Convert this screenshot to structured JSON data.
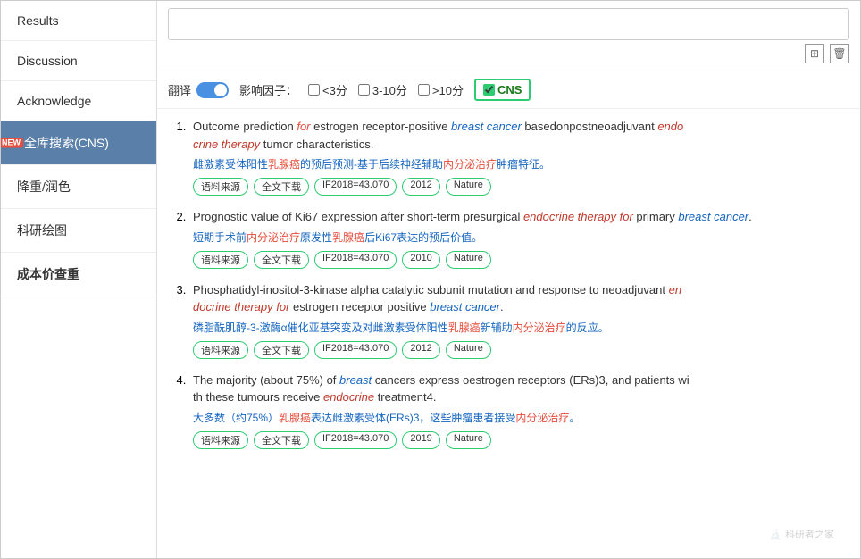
{
  "sidebar": {
    "items": [
      {
        "label": "Results",
        "active": false,
        "id": "results"
      },
      {
        "label": "Discussion",
        "active": false,
        "id": "discussion"
      },
      {
        "label": "Acknowledge",
        "active": false,
        "id": "acknowledge"
      },
      {
        "label": "全库搜索(CNS)",
        "active": true,
        "id": "cns-search",
        "hasNew": true
      },
      {
        "label": "降重/润色",
        "active": false,
        "id": "reduce"
      },
      {
        "label": "科研绘图",
        "active": false,
        "id": "drawing"
      },
      {
        "label": "成本价查重",
        "active": false,
        "id": "cost-check"
      }
    ]
  },
  "filter": {
    "translate_label": "翻译",
    "impact_label": "影响因子：",
    "options": [
      {
        "label": "<3分",
        "checked": false
      },
      {
        "label": "3-10分",
        "checked": false
      },
      {
        "label": ">10分",
        "checked": false
      }
    ],
    "cns_label": "CNS",
    "cns_checked": true
  },
  "results": [
    {
      "index": 1,
      "title_parts": [
        {
          "text": "Outcome prediction ",
          "style": "normal"
        },
        {
          "text": "for",
          "style": "italic-red"
        },
        {
          "text": " estrogen receptor-positive ",
          "style": "normal"
        },
        {
          "text": "breast cancer",
          "style": "italic-blue"
        },
        {
          "text": " basedonpostneoadjuvant ",
          "style": "normal"
        },
        {
          "text": "endo",
          "style": "italic-red"
        },
        {
          "text": "crine therapy",
          "style": "italic-red"
        },
        {
          "text": " tumor characteristics.",
          "style": "normal"
        }
      ],
      "title": "Outcome prediction for estrogen receptor-positive breast cancer basedonpostneoadjuvant endocrine therapy tumor characteristics.",
      "chinese": "雌激素受体阳性乳腺癌的预后预测-基于后续神经辅助内分泌治疗肿瘤特征。",
      "tags": [
        "语料来源",
        "全文下载",
        "IF2018=43.070",
        "2012",
        "Nature"
      ]
    },
    {
      "index": 2,
      "title": "Prognostic value of Ki67 expression after short-term presurgical endocrine therapy for primary breast cancer.",
      "chinese": "短期手术前内分泌治疗原发性乳腺癌后Ki67表达的预后价值。",
      "tags": [
        "语料来源",
        "全文下载",
        "IF2018=43.070",
        "2010",
        "Nature"
      ]
    },
    {
      "index": 3,
      "title": "Phosphatidyl-inositol-3-kinase alpha catalytic subunit mutation and response to neoadjuvant endocrine therapy for estrogen receptor positive breast cancer.",
      "chinese": "磷脂酰肌醇-3-激酶α催化亚基突变及对雌激素受体阳性乳腺癌新辅助内分泌治疗的反应。",
      "tags": [
        "语料来源",
        "全文下载",
        "IF2018=43.070",
        "2012",
        "Nature"
      ]
    },
    {
      "index": 4,
      "title": "The majority (about 75%) of breast cancers express oestrogen receptors (ERs)3, and patients with these tumours receive endocrine treatment4.",
      "chinese": "大多数（约75%）乳腺癌表达雌激素受体(ERs)3，这些肿瘤患者接受内分泌治疗。",
      "tags": [
        "语料来源",
        "全文下载",
        "IF2018=43.070",
        "2019",
        "Nature"
      ]
    }
  ],
  "watermark": {
    "icon": "🔬",
    "text": "科研者之家"
  }
}
